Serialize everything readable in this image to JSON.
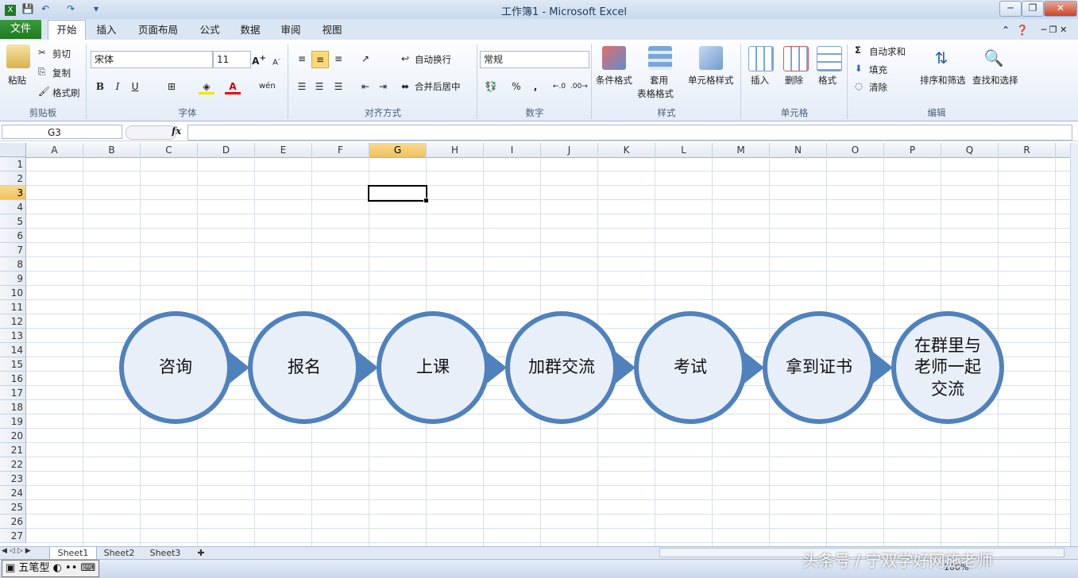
{
  "window": {
    "title": "工作簿1 - Microsoft Excel"
  },
  "tabs": {
    "file": "文件",
    "items": [
      "开始",
      "插入",
      "页面布局",
      "公式",
      "数据",
      "审阅",
      "视图"
    ]
  },
  "ribbon": {
    "clipboard": {
      "paste": "粘贴",
      "cut": "剪切",
      "copy": "复制",
      "format_painter": "格式刷",
      "label": "剪贴板"
    },
    "font": {
      "name": "宋体",
      "size": "11",
      "label": "字体"
    },
    "alignment": {
      "wrap": "自动换行",
      "merge": "合并后居中",
      "label": "对齐方式"
    },
    "number": {
      "format": "常规",
      "label": "数字"
    },
    "styles": {
      "conditional": "条件格式",
      "table_line1": "套用",
      "table_line2": "表格格式",
      "cell_styles": "单元格样式",
      "label": "样式"
    },
    "cells": {
      "insert": "插入",
      "delete": "删除",
      "format": "格式",
      "label": "单元格"
    },
    "editing": {
      "autosum": "自动求和",
      "fill": "填充",
      "clear": "清除",
      "sort": "排序和筛选",
      "find": "查找和选择",
      "label": "编辑"
    }
  },
  "formula_bar": {
    "name_box": "G3",
    "fx": "fx",
    "value": ""
  },
  "sheet": {
    "columns": [
      "A",
      "B",
      "C",
      "D",
      "E",
      "F",
      "G",
      "H",
      "I",
      "J",
      "K",
      "L",
      "M",
      "N",
      "O",
      "P",
      "Q",
      "R"
    ],
    "rows": [
      "1",
      "2",
      "3",
      "4",
      "5",
      "6",
      "7",
      "8",
      "9",
      "10",
      "11",
      "12",
      "13",
      "14",
      "15",
      "16",
      "17",
      "18",
      "19",
      "20",
      "21",
      "22",
      "23",
      "24",
      "25",
      "26",
      "27"
    ],
    "selected_column": "G",
    "selected_row": "3"
  },
  "process_steps": [
    "咨询",
    "报名",
    "上课",
    "加群交流",
    "考试",
    "拿到证书",
    "在群里与\n老师一起\n交流"
  ],
  "sheet_tabs": [
    "Sheet1",
    "Sheet2",
    "Sheet3"
  ],
  "status": {
    "ime": "五笔型",
    "zoom": "100%",
    "watermark": "头条号 / 宁双学好网施老师"
  },
  "colors": {
    "accent": "#4f81bd",
    "circle_fill": "#e9eff8",
    "file_tab": "#2a8a2c",
    "selection": "#f1c15f"
  }
}
